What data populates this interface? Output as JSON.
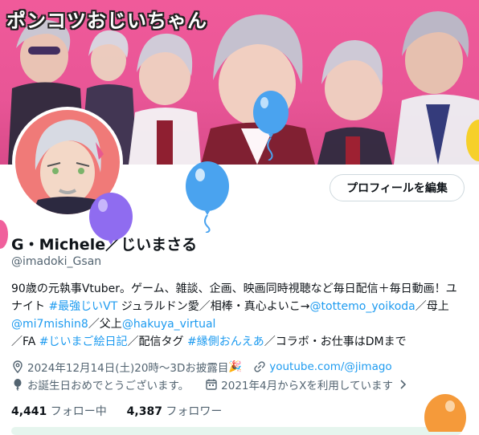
{
  "banner": {
    "title": "ポンコツおじいちゃん"
  },
  "profile": {
    "display_name": "G・Michele／じいまさる",
    "handle": "@imadoki_Gsan",
    "edit_button": "プロフィールを編集"
  },
  "bio": {
    "p1": "90歳の元執事Vtuber。ゲーム、雑談、企画、映画同時視聴など毎日配信＋毎日動画！ユナイト ",
    "tag1": "#最強じいVT",
    "p2": " ジュラルドン愛／相棒・真心よいこ→",
    "mention1": "@tottemo_yoikoda",
    "p3": "／母上",
    "mention2": "@mi7mishin8",
    "p4": "／父上",
    "mention3": "@hakuya_virtual",
    "p5": "／FA ",
    "tag2": "#じいまご絵日記",
    "p6": "／配信タグ ",
    "tag3": "#縁側おんえあ",
    "p7": "／コラボ・お仕事はDMまで"
  },
  "meta": {
    "location": "2024年12月14日(土)20時～3Dお披露目",
    "location_icon": "location-pin-icon",
    "party_emoji": "🎉",
    "link": "youtube.com/@jimago",
    "link_icon": "link-icon",
    "birthday": "お誕生日おめでとうございます。",
    "birthday_icon": "balloon-icon",
    "joined": "2021年4月からXを利用しています",
    "joined_icon": "calendar-icon",
    "joined_chevron": "chevron-right-icon"
  },
  "stats": {
    "following_count": "4,441",
    "following_label": "フォロー中",
    "followers_count": "4,387",
    "followers_label": "フォロワー"
  },
  "colors": {
    "banner_pink": "#e85596",
    "link_blue": "#1d9bf0",
    "muted_gray": "#536471",
    "balloon_blue": "#4aa3ef",
    "balloon_purple": "#8f6cf0",
    "balloon_orange": "#f59a3a",
    "balloon_pink": "#f0609c",
    "balloon_yellow": "#f6d02a"
  }
}
